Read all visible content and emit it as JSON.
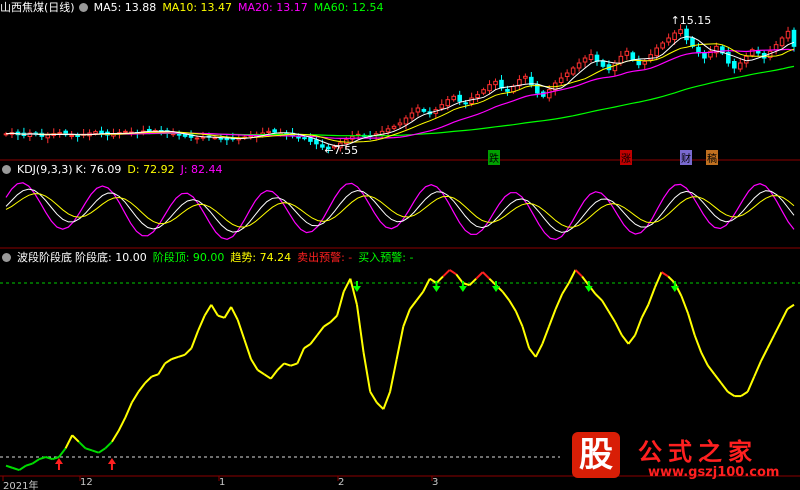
{
  "main_panel": {
    "title": "山西焦煤(日线)",
    "indicators": [
      {
        "label": "MA5: 13.88",
        "color": "#ffffff"
      },
      {
        "label": "MA10: 13.47",
        "color": "#ffff00"
      },
      {
        "label": "MA20: 13.17",
        "color": "#ff00ff"
      },
      {
        "label": "MA60: 12.54",
        "color": "#00ff00"
      }
    ],
    "high_marker": "15.15",
    "low_marker": "7.55",
    "events": [
      {
        "label": "跌",
        "bg": "#00a000"
      },
      {
        "label": "涨",
        "bg": "#c00000"
      },
      {
        "label": "财",
        "bg": "#7a6ad0"
      },
      {
        "label": "稿",
        "bg": "#c07020"
      }
    ]
  },
  "kdj_panel": {
    "title": "KDJ(9,3,3)",
    "values": [
      {
        "label": "K: 76.09",
        "color": "#ffffff"
      },
      {
        "label": "D: 72.92",
        "color": "#ffff00"
      },
      {
        "label": "J: 82.44",
        "color": "#ff00ff"
      }
    ]
  },
  "wave_panel": {
    "title": "波段阶段底",
    "values": [
      {
        "label": "阶段底: 10.00",
        "color": "#ffffff"
      },
      {
        "label": "阶段顶: 90.00",
        "color": "#00ff00"
      },
      {
        "label": "趋势: 74.24",
        "color": "#ffff00"
      },
      {
        "label": "卖出预警: -",
        "color": "#ff2020"
      },
      {
        "label": "买入预警: -",
        "color": "#00ff00"
      }
    ]
  },
  "x_axis_labels": [
    "2021年",
    "12",
    "1",
    "2",
    "3"
  ],
  "watermark": {
    "char": "股",
    "name": "公式之家",
    "url": "www.gszj100.com"
  },
  "colors": {
    "up": "#ff3030",
    "down": "#00ffff",
    "ma5": "#ffffff",
    "ma10": "#ffff00",
    "ma20": "#ff00ff",
    "ma60": "#00ff00",
    "k": "#ffffff",
    "d": "#ffff00",
    "j": "#ff00ff",
    "trend": "#ffff00",
    "grid": "#8b0000"
  },
  "chart_data": [
    {
      "type": "candlestick",
      "title": "山西焦煤(日线)",
      "series": [
        {
          "name": "MA5",
          "last": 13.88
        },
        {
          "name": "MA10",
          "last": 13.47
        },
        {
          "name": "MA20",
          "last": 13.17
        },
        {
          "name": "MA60",
          "last": 12.54
        }
      ],
      "annotations": [
        "15.15",
        "7.55"
      ],
      "ylim": [
        7.2,
        15.6
      ],
      "close": [
        8.65,
        8.72,
        8.6,
        8.55,
        8.7,
        8.62,
        8.5,
        8.58,
        8.66,
        8.72,
        8.6,
        8.55,
        8.5,
        8.62,
        8.7,
        8.78,
        8.66,
        8.58,
        8.64,
        8.72,
        8.8,
        8.76,
        8.7,
        8.82,
        8.9,
        8.85,
        8.78,
        8.72,
        8.66,
        8.58,
        8.5,
        8.44,
        8.4,
        8.45,
        8.5,
        8.42,
        8.36,
        8.3,
        8.35,
        8.4,
        8.46,
        8.55,
        8.62,
        8.7,
        8.8,
        8.76,
        8.7,
        8.62,
        8.55,
        8.45,
        8.38,
        8.2,
        8.05,
        7.85,
        7.75,
        7.9,
        8.1,
        8.3,
        8.5,
        8.62,
        8.55,
        8.5,
        8.65,
        8.8,
        8.95,
        9.1,
        9.3,
        9.6,
        9.9,
        10.2,
        10.0,
        9.85,
        10.1,
        10.4,
        10.7,
        10.9,
        10.6,
        10.5,
        10.8,
        11.0,
        11.3,
        11.6,
        11.8,
        11.4,
        11.2,
        11.5,
        11.9,
        12.1,
        11.6,
        11.1,
        10.9,
        11.3,
        11.7,
        12.0,
        12.3,
        12.6,
        12.9,
        13.2,
        13.4,
        13.0,
        12.7,
        12.5,
        12.9,
        13.3,
        13.6,
        13.1,
        12.8,
        13.0,
        13.4,
        13.8,
        14.1,
        14.4,
        14.7,
        14.9,
        14.3,
        13.9,
        13.5,
        13.2,
        13.6,
        13.9,
        13.5,
        12.9,
        12.6,
        12.9,
        13.3,
        13.7,
        13.5,
        13.2,
        13.6,
        14.0,
        14.4,
        14.8,
        13.9
      ]
    },
    {
      "type": "line",
      "title": "KDJ(9,3,3)",
      "series": [
        {
          "name": "K",
          "last": 76.09
        },
        {
          "name": "D",
          "last": 72.92
        },
        {
          "name": "J",
          "last": 82.44
        }
      ],
      "ylim": [
        -10,
        110
      ]
    },
    {
      "type": "line",
      "title": "波段阶段底",
      "reference_lines": [
        {
          "name": "阶段底",
          "value": 10.0
        },
        {
          "name": "阶段顶",
          "value": 90.0
        }
      ],
      "series": [
        {
          "name": "趋势",
          "last": 74.24,
          "values": [
            6,
            5,
            4,
            6,
            7,
            9,
            10,
            9,
            10,
            14,
            20,
            17,
            14,
            13,
            12,
            14,
            17,
            22,
            28,
            35,
            40,
            44,
            47,
            48,
            53,
            55,
            56,
            57,
            60,
            68,
            75,
            80,
            75,
            74,
            79,
            73,
            64,
            55,
            50,
            48,
            46,
            50,
            53,
            52,
            53,
            60,
            62,
            66,
            70,
            72,
            75,
            86,
            92,
            80,
            58,
            40,
            35,
            32,
            40,
            55,
            70,
            78,
            82,
            86,
            92,
            90,
            93,
            96,
            94,
            90,
            89,
            92,
            95,
            92,
            89,
            86,
            82,
            77,
            70,
            60,
            56,
            62,
            70,
            78,
            85,
            90,
            96,
            93,
            89,
            85,
            82,
            77,
            72,
            66,
            62,
            66,
            74,
            80,
            88,
            95,
            93,
            90,
            84,
            76,
            66,
            58,
            52,
            48,
            44,
            40,
            38,
            38,
            40,
            47,
            54,
            60,
            66,
            72,
            78,
            80
          ]
        }
      ],
      "annotations": [
        "卖出预警",
        "买入预警"
      ],
      "ylim": [
        0,
        100
      ]
    }
  ]
}
